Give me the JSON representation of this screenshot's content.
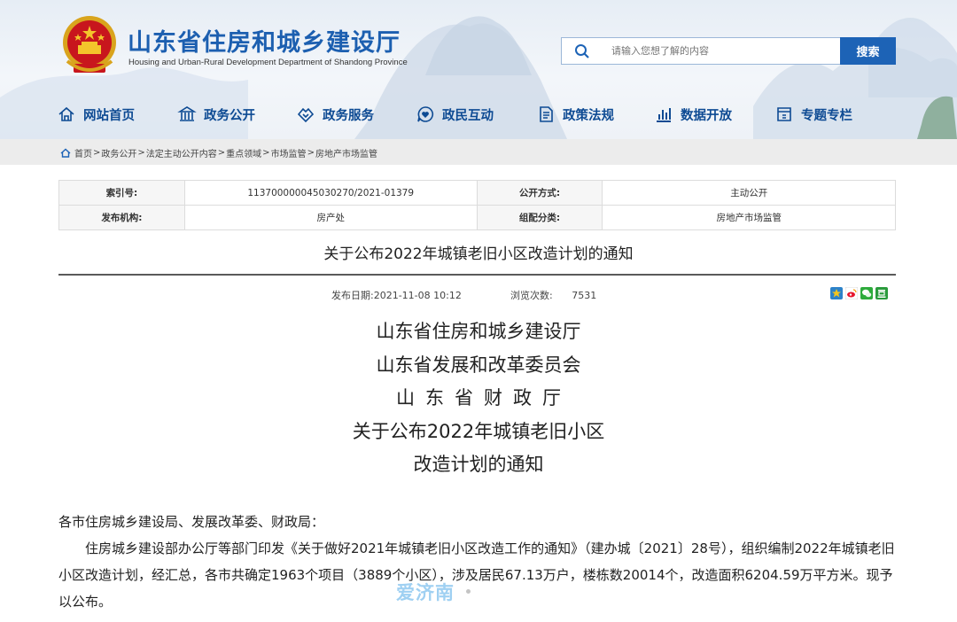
{
  "header": {
    "title": "山东省住房和城乡建设厅",
    "subtitle": "Housing and Urban-Rural Development Department of Shandong Province",
    "search_placeholder": "请输入您想了解的内容",
    "search_button": "搜索",
    "brand_color": "#1c5fb0"
  },
  "nav": [
    {
      "label": "网站首页",
      "icon": "home-icon"
    },
    {
      "label": "政务公开",
      "icon": "building-icon"
    },
    {
      "label": "政务服务",
      "icon": "handshake-icon"
    },
    {
      "label": "政民互动",
      "icon": "chat-heart-icon"
    },
    {
      "label": "政策法规",
      "icon": "document-icon"
    },
    {
      "label": "数据开放",
      "icon": "bar-chart-icon"
    },
    {
      "label": "专题专栏",
      "icon": "column-icon"
    }
  ],
  "breadcrumb": [
    "首页",
    "政务公开",
    "法定主动公开内容",
    "重点领域",
    "市场监管",
    "房地产市场监管"
  ],
  "info": {
    "index_label": "索引号:",
    "index_value": "113700000045030270/2021-01379",
    "mode_label": "公开方式:",
    "mode_value": "主动公开",
    "issuer_label": "发布机构:",
    "issuer_value": "房产处",
    "category_label": "组配分类:",
    "category_value": "房地产市场监管"
  },
  "article": {
    "title": "关于公布2022年城镇老旧小区改造计划的通知",
    "date_label": "发布日期:",
    "date_value": "2021-11-08 10:12",
    "views_label": "浏览次数:",
    "views_value": "7531",
    "heading_lines": [
      "山东省住房和城乡建设厅",
      "山东省发展和改革委员会",
      "山东省财政厅",
      "关于公布2022年城镇老旧小区",
      "改造计划的通知"
    ],
    "salutation": "各市住房城乡建设局、发展改革委、财政局：",
    "paragraph": "住房城乡建设部办公厅等部门印发《关于做好2021年城镇老旧小区改造工作的通知》（建办城〔2021〕28号），组织编制2022年城镇老旧小区改造计划，经汇总，各市共确定1963个项目（3889个小区），涉及居民67.13万户，楼栋数20014个，改造面积6204.59万平方米。现予以公布。"
  },
  "watermark": "爱济南",
  "share_icons": [
    "qzone-icon",
    "weibo-icon",
    "wechat-icon",
    "douban-icon"
  ]
}
